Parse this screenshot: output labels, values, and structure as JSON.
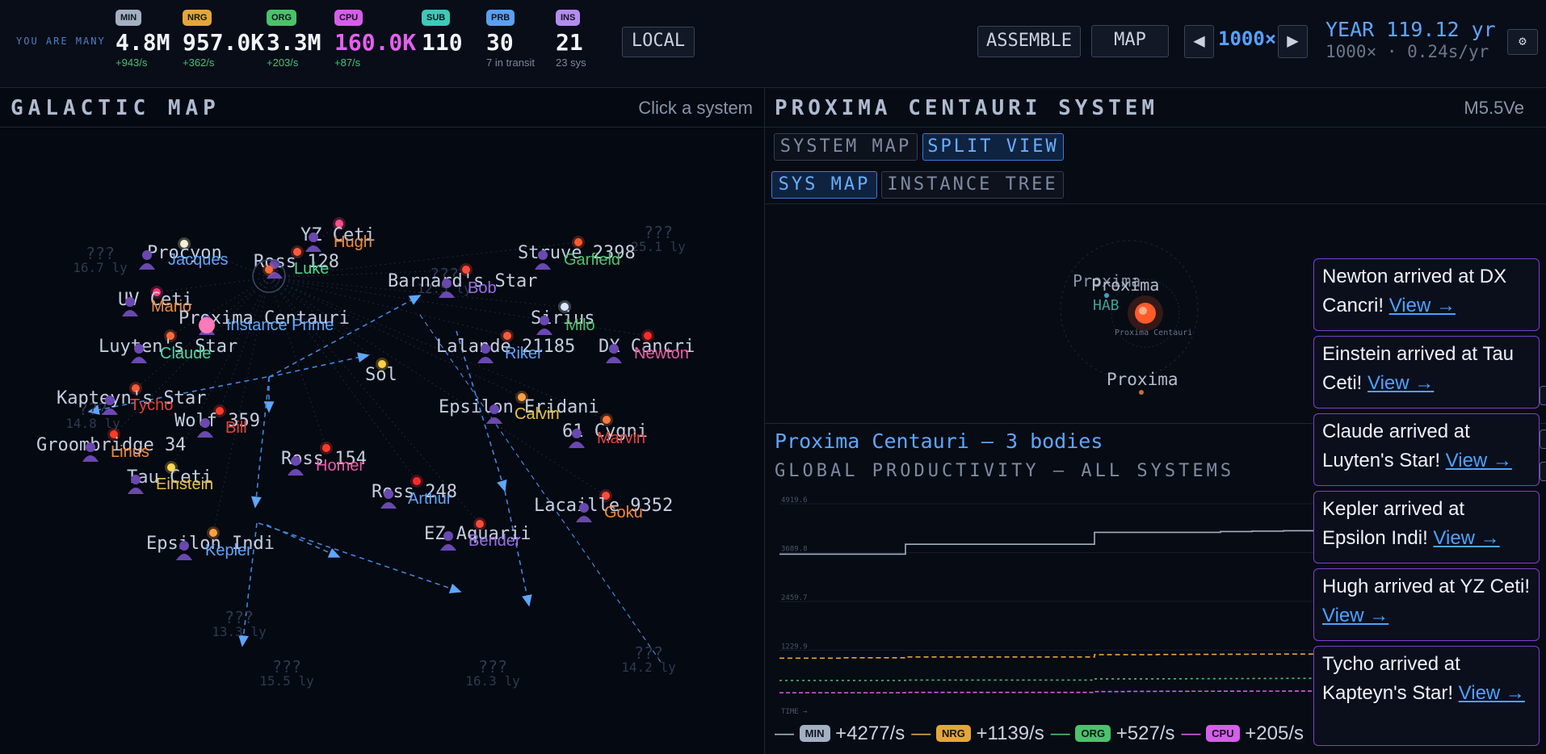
{
  "tagline": "YOU ARE MANY",
  "resources": [
    {
      "badge": "MIN",
      "value": "4.8M",
      "rate": "+943/s",
      "badge_color": "#a3b0c2",
      "value_color": "#f2f5fa",
      "rate_style": "green"
    },
    {
      "badge": "NRG",
      "value": "957.0K",
      "rate": "+362/s",
      "badge_color": "#e3a63a",
      "value_color": "#f2f5fa",
      "rate_style": "green"
    },
    {
      "badge": "ORG",
      "value": "3.3M",
      "rate": "+203/s",
      "badge_color": "#4cc26a",
      "value_color": "#f2f5fa",
      "rate_style": "green"
    },
    {
      "badge": "CPU",
      "value": "160.0K",
      "rate": "+87/s",
      "badge_color": "#d65ee8",
      "value_color": "#e65ff0",
      "rate_style": "green"
    },
    {
      "badge": "SUB",
      "value": "110",
      "rate": "",
      "badge_color": "#3ec9b8",
      "value_color": "#f2f5fa",
      "rate_style": "gray"
    },
    {
      "badge": "PRB",
      "value": "30",
      "rate": "7 in transit",
      "badge_color": "#5aa0f0",
      "value_color": "#f2f5fa",
      "rate_style": "gray"
    },
    {
      "badge": "INS",
      "value": "21",
      "rate": "23 sys",
      "badge_color": "#b48cf0",
      "value_color": "#f2f5fa",
      "rate_style": "gray"
    }
  ],
  "topbar": {
    "local_label": "LOCAL",
    "assemble_label": "ASSEMBLE",
    "map_label": "MAP",
    "prev_icon": "◀",
    "next_icon": "▶",
    "speed": "1000×",
    "year": "YEAR 119.12 yr",
    "year_sub": "1000× · 0.24s/yr",
    "settings_icon": "⚙"
  },
  "left_panel": {
    "title": "GALACTIC MAP",
    "hint": "Click a system"
  },
  "map": {
    "systems": [
      {
        "name": "Procyon",
        "probe": "Jacques",
        "probe_color": "#5ea6ff",
        "star_color": "#f4efd0"
      },
      {
        "name": "YZ Ceti",
        "probe": "Hugh",
        "probe_color": "#f08a3c",
        "star_color": "#ff4f8a"
      },
      {
        "name": "Ross 128",
        "probe": "Luke",
        "probe_color": "#4cd68a",
        "star_color": "#ff5a3a"
      },
      {
        "name": "Struve 2398",
        "probe": "Garfield",
        "probe_color": "#4cc26a",
        "star_color": "#ff5a2e"
      },
      {
        "name": "Barnard's Star",
        "probe": "Bob",
        "probe_color": "#9a6ee8",
        "star_color": "#ff4a3a"
      },
      {
        "name": "UV Ceti",
        "probe": "Mario",
        "probe_color": "#f08a3c",
        "star_color": "#ff3a7a"
      },
      {
        "name": "Proxima Centauri",
        "probe": "Instance Prime",
        "probe_color": "#5ea6ff",
        "star_color": "#ff6a3a"
      },
      {
        "name": "Sirius",
        "probe": "Milo",
        "probe_color": "#4cc26a",
        "star_color": "#d8e6ff"
      },
      {
        "name": "Luyten's Star",
        "probe": "Claude",
        "probe_color": "#4cd6a0",
        "star_color": "#ff6a3a"
      },
      {
        "name": "Lalande 21185",
        "probe": "Riker",
        "probe_color": "#5ea6ff",
        "star_color": "#ff5a3a"
      },
      {
        "name": "DX Cancri",
        "probe": "Newton",
        "probe_color": "#e85aa8",
        "star_color": "#ff2a2a"
      },
      {
        "name": "Sol",
        "probe": "",
        "probe_color": "#5ea6ff",
        "star_color": "#ffd040"
      },
      {
        "name": "Kapteyn's Star",
        "probe": "Tycho",
        "probe_color": "#e0443a",
        "star_color": "#ff5a3a"
      },
      {
        "name": "Epsilon Eridani",
        "probe": "Calvin",
        "probe_color": "#e8c040",
        "star_color": "#ffa040"
      },
      {
        "name": "Wolf 359",
        "probe": "Bill",
        "probe_color": "#e0443a",
        "star_color": "#ff3a2a"
      },
      {
        "name": "61 Cygni",
        "probe": "Marvin",
        "probe_color": "#e0443a",
        "star_color": "#ff7a3a"
      },
      {
        "name": "Groombridge 34",
        "probe": "Linus",
        "probe_color": "#f08a3c",
        "star_color": "#ff3a2a"
      },
      {
        "name": "Ross 154",
        "probe": "Homer",
        "probe_color": "#e85aa8",
        "star_color": "#ff3a2a"
      },
      {
        "name": "Tau Ceti",
        "probe": "Einstein",
        "probe_color": "#e8c040",
        "star_color": "#ffd850"
      },
      {
        "name": "Ross 248",
        "probe": "Arthur",
        "probe_color": "#5ea6ff",
        "star_color": "#ff2a2a"
      },
      {
        "name": "Lacaille 9352",
        "probe": "Goku",
        "probe_color": "#f08a3c",
        "star_color": "#ff4a3a"
      },
      {
        "name": "EZ Aquarii",
        "probe": "Bender",
        "probe_color": "#9a6ee8",
        "star_color": "#ff4a3a"
      },
      {
        "name": "Epsilon Indi",
        "probe": "Kepler",
        "probe_color": "#5ea6ff",
        "star_color": "#ffa040"
      }
    ],
    "unknowns": [
      {
        "label": "???",
        "distance": "16.7 ly"
      },
      {
        "label": "???",
        "distance": "25.1 ly"
      },
      {
        "label": "???",
        "distance": "12.5 ly"
      },
      {
        "label": "???",
        "distance": "14.8 ly"
      },
      {
        "label": "???",
        "distance": "13.3 ly"
      },
      {
        "label": "???",
        "distance": "15.5 ly"
      },
      {
        "label": "???",
        "distance": "16.3 ly"
      },
      {
        "label": "???",
        "distance": "14.2 ly"
      }
    ]
  },
  "right_panel": {
    "title": "PROXIMA CENTAURI SYSTEM",
    "spectral": "M5.5Ve",
    "tabs": [
      "SYSTEM MAP",
      "SPLIT VIEW"
    ],
    "subtabs": [
      "SYS MAP",
      "INSTANCE TREE"
    ],
    "system_map": {
      "labels": [
        "Proxima",
        "Proxima",
        "HAB",
        "Proxima Centauri",
        "Proxima"
      ]
    },
    "bodies_text": "Proxima Centauri — 3 bodies",
    "productivity_title": "GLOBAL PRODUCTIVITY — ALL SYSTEMS",
    "legend": [
      {
        "badge": "MIN",
        "rate": "+4277/s",
        "color": "#a3b0c2"
      },
      {
        "badge": "NRG",
        "rate": "+1139/s",
        "color": "#e3a63a"
      },
      {
        "badge": "ORG",
        "rate": "+527/s",
        "color": "#4cc26a"
      },
      {
        "badge": "CPU",
        "rate": "+205/s",
        "color": "#d65ee8"
      }
    ]
  },
  "chart_data": {
    "type": "line",
    "title": "GLOBAL PRODUCTIVITY — ALL SYSTEMS",
    "xlabel": "TIME →",
    "ylabel": "",
    "yticks": [
      "4919.6",
      "3689.8",
      "2459.7",
      "1229.9"
    ],
    "ylim": [
      0,
      4919.6
    ],
    "x": [
      0,
      1,
      2,
      3,
      4,
      5,
      6,
      7,
      8,
      9,
      10,
      11,
      12,
      13,
      14,
      15,
      16,
      17,
      18,
      19,
      20
    ],
    "series": [
      {
        "name": "MIN",
        "color": "#a3b0c2",
        "values": [
          3650,
          3650,
          3650,
          3650,
          3900,
          3900,
          3900,
          3900,
          3900,
          3900,
          4200,
          4200,
          4200,
          4200,
          4220,
          4230,
          4240,
          4250,
          4260,
          4270,
          4277
        ]
      },
      {
        "name": "NRG",
        "color": "#e3a63a",
        "values": [
          1030,
          1030,
          1040,
          1040,
          1060,
          1060,
          1060,
          1060,
          1060,
          1060,
          1120,
          1120,
          1125,
          1128,
          1130,
          1132,
          1134,
          1135,
          1137,
          1138,
          1139
        ]
      },
      {
        "name": "ORG",
        "color": "#4cc26a",
        "values": [
          470,
          470,
          470,
          470,
          480,
          480,
          480,
          480,
          480,
          480,
          510,
          510,
          512,
          515,
          518,
          520,
          522,
          524,
          525,
          526,
          527
        ]
      },
      {
        "name": "CPU",
        "color": "#d65ee8",
        "values": [
          160,
          160,
          160,
          160,
          170,
          170,
          170,
          170,
          170,
          170,
          190,
          195,
          196,
          198,
          200,
          201,
          202,
          203,
          204,
          204,
          205
        ]
      }
    ]
  },
  "notifications": [
    {
      "text": "Newton arrived at DX Cancri!",
      "link": "View →"
    },
    {
      "text": "Einstein arrived at Tau Ceti!",
      "link": "View →"
    },
    {
      "text": "Claude arrived at Luyten's Star!",
      "link": "View →"
    },
    {
      "text": "Kepler arrived at Epsilon Indi!",
      "link": "View →"
    },
    {
      "text": "Hugh arrived at YZ Ceti!",
      "link": "View →"
    },
    {
      "text": "Tycho arrived at Kapteyn's Star!",
      "link": "View →"
    }
  ]
}
